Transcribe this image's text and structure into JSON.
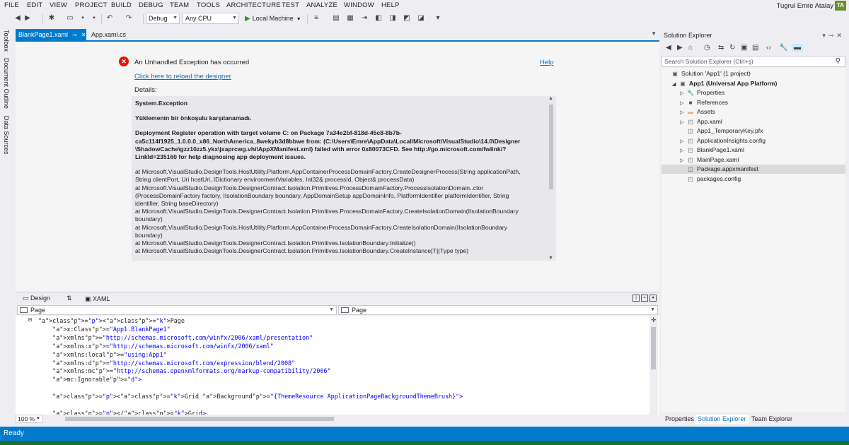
{
  "menu": [
    "FILE",
    "EDIT",
    "VIEW",
    "PROJECT",
    "BUILD",
    "DEBUG",
    "TEAM",
    "TOOLS",
    "ARCHITECTURE",
    "TEST",
    "ANALYZE",
    "WINDOW",
    "HELP"
  ],
  "user": {
    "name": "Tugrul Emre Atalay",
    "initials": "TA"
  },
  "toolbar": {
    "config": "Debug",
    "platform": "Any CPU",
    "run_label": "Local Machine"
  },
  "left_tabs": [
    "Toolbox",
    "Document Outline",
    "Data Sources"
  ],
  "doc_tabs": {
    "active": "BlankPage1.xaml",
    "inactive": "App.xaml.cs"
  },
  "designer": {
    "error_title": "An Unhandled Exception has occurred",
    "help": "Help",
    "reload": "Click here to reload the designer",
    "details_label": "Details:",
    "details": [
      {
        "t": "System.Exception",
        "b": true
      },
      {
        "t": "",
        "gap": true
      },
      {
        "t": "Yüklemenin bir önkoşulu karşılanamadı.",
        "b": true
      },
      {
        "t": "",
        "gap": true
      },
      {
        "t": "Deployment Register operation with target volume C: on Package 7a34e2bf-818d-45c8-8b7b-",
        "b": true
      },
      {
        "t": "ca5c114f1925_1.0.0.0_x86_NorthAmerica_8wekyb3d8bbwe from:  (C:\\Users\\Emre\\AppData\\Local\\Microsoft\\VisualStudio\\14.0\\Designer",
        "b": true
      },
      {
        "t": "\\ShadowCache\\gzz10zz5.ykx\\jxaprcwg.vhi\\AppXManifest.xml)  failed with error 0x80073CFD. See http://go.microsoft.com/fwlink/?",
        "b": true
      },
      {
        "t": "LinkId=235160 for help diagnosing app deployment issues.",
        "b": true
      },
      {
        "t": "",
        "gap": true
      },
      {
        "t": "   at Microsoft.VisualStudio.DesignTools.HostUtility.Platform.AppContainerProcessDomainFactory.CreateDesignerProcess(String applicationPath,"
      },
      {
        "t": "String clientPort, Uri hostUri, IDictionary environmentVariables, Int32& processId, Object& processData)"
      },
      {
        "t": "   at Microsoft.VisualStudio.DesignTools.DesignerContract.Isolation.Primitives.ProcessDomainFactory.ProcessIsolationDomain..ctor"
      },
      {
        "t": "(ProcessDomainFactory factory, IIsolationBoundary boundary, AppDomainSetup appDomainInfo, PlatformIdentifier platformIdentifier, String"
      },
      {
        "t": "identifier, String baseDirectory)"
      },
      {
        "t": "   at Microsoft.VisualStudio.DesignTools.DesignerContract.Isolation.Primitives.ProcessDomainFactory.CreateIsolationDomain(IIsolationBoundary"
      },
      {
        "t": "boundary)"
      },
      {
        "t": "   at Microsoft.VisualStudio.DesignTools.HostUtility.Platform.AppContainerProcessDomainFactory.CreateIsolationDomain(IIsolationBoundary"
      },
      {
        "t": "boundary)"
      },
      {
        "t": "   at Microsoft.VisualStudio.DesignTools.DesignerContract.Isolation.Primitives.IsolationBoundary.Initialize()"
      },
      {
        "t": "   at Microsoft.VisualStudio.DesignTools.DesignerContract.Isolation.Primitives.IsolationBoundary.CreateInstance[T](Type type)"
      }
    ]
  },
  "split": {
    "design": "Design",
    "xaml": "XAML"
  },
  "nav": {
    "left": "Page",
    "right": "Page"
  },
  "code_lines": [
    "<Page",
    "    x:Class=\"App1.BlankPage1\"",
    "    xmlns=\"http://schemas.microsoft.com/winfx/2006/xaml/presentation\"",
    "    xmlns:x=\"http://schemas.microsoft.com/winfx/2006/xaml\"",
    "    xmlns:local=\"using:App1\"",
    "    xmlns:d=\"http://schemas.microsoft.com/expression/blend/2008\"",
    "    xmlns:mc=\"http://schemas.openxmlformats.org/markup-compatibility/2006\"",
    "    mc:Ignorable=\"d\">",
    "",
    "    <Grid Background=\"{ThemeResource ApplicationPageBackgroundThemeBrush}\">",
    "",
    "    </Grid>"
  ],
  "zoom": "100 %",
  "solution_explorer": {
    "title": "Solution Explorer",
    "search_placeholder": "Search Solution Explorer (Ctrl+ş)",
    "items": [
      {
        "label": "Solution 'App1' (1 project)",
        "indent": 0,
        "icon": "solution-icon",
        "tw": ""
      },
      {
        "label": "App1 (Universal App Platform)",
        "indent": 1,
        "icon": "project-icon",
        "tw": "◢",
        "bold": true
      },
      {
        "label": "Properties",
        "indent": 2,
        "icon": "wrench-icon",
        "tw": "▷"
      },
      {
        "label": "References",
        "indent": 2,
        "icon": "references-icon",
        "tw": "▷"
      },
      {
        "label": "Assets",
        "indent": 2,
        "icon": "folder-icon",
        "tw": "▷"
      },
      {
        "label": "App.xaml",
        "indent": 2,
        "icon": "xaml-file-icon",
        "tw": "▷"
      },
      {
        "label": "App1_TemporaryKey.pfx",
        "indent": 2,
        "icon": "key-file-icon",
        "tw": ""
      },
      {
        "label": "ApplicationInsights.config",
        "indent": 2,
        "icon": "config-file-icon",
        "tw": "▷"
      },
      {
        "label": "BlankPage1.xaml",
        "indent": 2,
        "icon": "xaml-file-icon",
        "tw": "▷"
      },
      {
        "label": "MainPage.xaml",
        "indent": 2,
        "icon": "xaml-file-icon",
        "tw": "▷"
      },
      {
        "label": "Package.appxmanifest",
        "indent": 2,
        "icon": "manifest-file-icon",
        "tw": "",
        "selected": true
      },
      {
        "label": "packages.config",
        "indent": 2,
        "icon": "config-file-icon",
        "tw": ""
      }
    ],
    "bottom_tabs": [
      "Properties",
      "Solution Explorer",
      "Team Explorer"
    ]
  },
  "status": "Ready"
}
